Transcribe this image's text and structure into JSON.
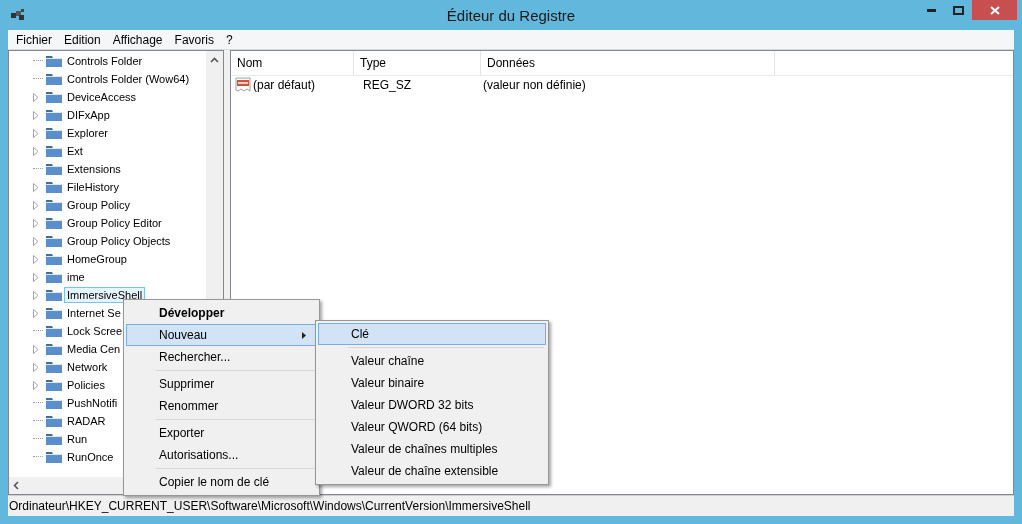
{
  "window": {
    "title": "Éditeur du Registre"
  },
  "menu_bar": [
    "Fichier",
    "Edition",
    "Affichage",
    "Favoris",
    "?"
  ],
  "tree": {
    "items": [
      {
        "label": "Controls Folder",
        "expandable": false,
        "selected": false
      },
      {
        "label": "Controls Folder (Wow64)",
        "expandable": false,
        "selected": false
      },
      {
        "label": "DeviceAccess",
        "expandable": true,
        "selected": false
      },
      {
        "label": "DIFxApp",
        "expandable": true,
        "selected": false
      },
      {
        "label": "Explorer",
        "expandable": true,
        "selected": false
      },
      {
        "label": "Ext",
        "expandable": true,
        "selected": false
      },
      {
        "label": "Extensions",
        "expandable": false,
        "selected": false
      },
      {
        "label": "FileHistory",
        "expandable": true,
        "selected": false
      },
      {
        "label": "Group Policy",
        "expandable": true,
        "selected": false
      },
      {
        "label": "Group Policy Editor",
        "expandable": true,
        "selected": false
      },
      {
        "label": "Group Policy Objects",
        "expandable": true,
        "selected": false
      },
      {
        "label": "HomeGroup",
        "expandable": true,
        "selected": false
      },
      {
        "label": "ime",
        "expandable": true,
        "selected": false
      },
      {
        "label": "ImmersiveShell",
        "expandable": true,
        "selected": true
      },
      {
        "label": "Internet Se",
        "expandable": true,
        "selected": false
      },
      {
        "label": "Lock Scree",
        "expandable": false,
        "selected": false
      },
      {
        "label": "Media Cen",
        "expandable": true,
        "selected": false
      },
      {
        "label": "Network",
        "expandable": true,
        "selected": false
      },
      {
        "label": "Policies",
        "expandable": true,
        "selected": false
      },
      {
        "label": "PushNotifi",
        "expandable": false,
        "selected": false
      },
      {
        "label": "RADAR",
        "expandable": false,
        "selected": false
      },
      {
        "label": "Run",
        "expandable": false,
        "selected": false
      },
      {
        "label": "RunOnce",
        "expandable": false,
        "selected": false
      }
    ]
  },
  "values_table": {
    "columns": [
      "Nom",
      "Type",
      "Données"
    ],
    "rows": [
      {
        "name": "(par défaut)",
        "type": "REG_SZ",
        "data": "(valeur non définie)"
      }
    ]
  },
  "context_menu": {
    "groups": [
      [
        {
          "label": "Développer",
          "default": true,
          "submenu": false,
          "selected": false
        },
        {
          "label": "Nouveau",
          "default": false,
          "submenu": true,
          "selected": true
        },
        {
          "label": "Rechercher...",
          "default": false,
          "submenu": false,
          "selected": false
        }
      ],
      [
        {
          "label": "Supprimer",
          "default": false,
          "submenu": false,
          "selected": false
        },
        {
          "label": "Renommer",
          "default": false,
          "submenu": false,
          "selected": false
        }
      ],
      [
        {
          "label": "Exporter",
          "default": false,
          "submenu": false,
          "selected": false
        },
        {
          "label": "Autorisations...",
          "default": false,
          "submenu": false,
          "selected": false
        }
      ],
      [
        {
          "label": "Copier le nom de clé",
          "default": false,
          "submenu": false,
          "selected": false
        }
      ]
    ]
  },
  "submenu": {
    "groups": [
      [
        {
          "label": "Clé",
          "selected": true
        }
      ],
      [
        {
          "label": "Valeur chaîne",
          "selected": false
        },
        {
          "label": "Valeur binaire",
          "selected": false
        },
        {
          "label": "Valeur DWORD 32 bits",
          "selected": false
        },
        {
          "label": "Valeur QWORD (64 bits)",
          "selected": false
        },
        {
          "label": "Valeur de chaînes multiples",
          "selected": false
        },
        {
          "label": "Valeur de chaîne extensible",
          "selected": false
        }
      ]
    ]
  },
  "status_bar": "Ordinateur\\HKEY_CURRENT_USER\\Software\\Microsoft\\Windows\\CurrentVersion\\ImmersiveShell"
}
